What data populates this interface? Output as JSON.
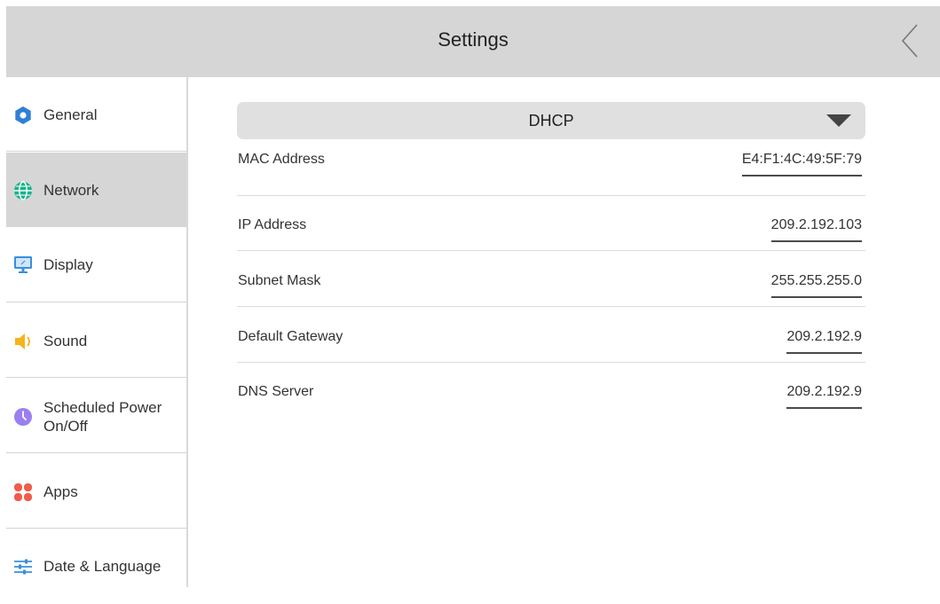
{
  "header": {
    "title": "Settings",
    "back_icon": "chevron-left-icon"
  },
  "sidebar": {
    "items": [
      {
        "label": "General",
        "icon": "gear-icon",
        "color": "#2f7fd6",
        "active": false
      },
      {
        "label": "Network",
        "icon": "globe-icon",
        "color": "#18b38a",
        "active": true
      },
      {
        "label": "Display",
        "icon": "monitor-icon",
        "color": "#3a8fde",
        "active": false
      },
      {
        "label": "Sound",
        "icon": "speaker-icon",
        "color": "#f5b41e",
        "active": false
      },
      {
        "label": "Scheduled Power On/Off",
        "icon": "clock-icon",
        "color": "#9a7ff0",
        "active": false
      },
      {
        "label": "Apps",
        "icon": "apps-icon",
        "color": "#f25a4a",
        "active": false
      },
      {
        "label": "Date & Language",
        "icon": "sliders-icon",
        "color": "#3a8fde",
        "active": false
      }
    ]
  },
  "network": {
    "mode": "DHCP",
    "fields": [
      {
        "label": "MAC Address",
        "value": "E4:F1:4C:49:5F:79"
      },
      {
        "label": "IP Address",
        "value": "209.2.192.103"
      },
      {
        "label": "Subnet Mask",
        "value": "255.255.255.0"
      },
      {
        "label": "Default Gateway",
        "value": "209.2.192.9"
      },
      {
        "label": "DNS Server",
        "value": "209.2.192.9"
      }
    ]
  }
}
